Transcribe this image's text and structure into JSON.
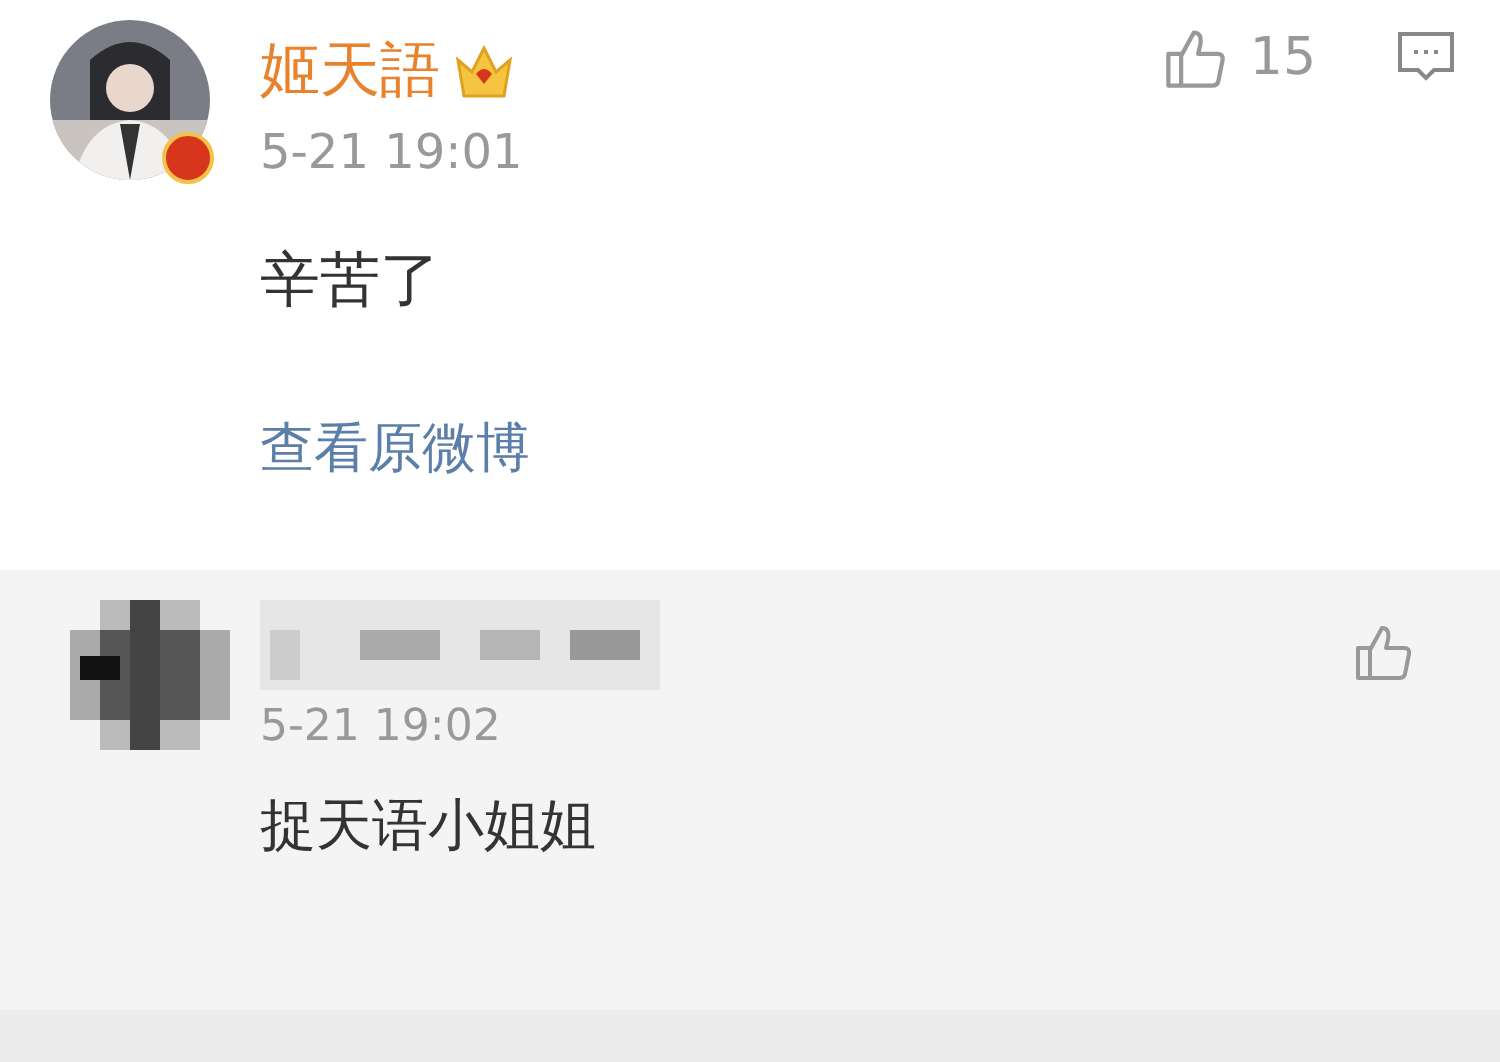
{
  "comment": {
    "name": "姬天語",
    "verified": true,
    "time": "5-21 19:01",
    "text": "辛苦了",
    "likes": "15",
    "link": "查看原微博"
  },
  "replies": [
    {
      "name_hidden": true,
      "time": "5-21 19:02",
      "text": "捉天语小姐姐"
    }
  ]
}
